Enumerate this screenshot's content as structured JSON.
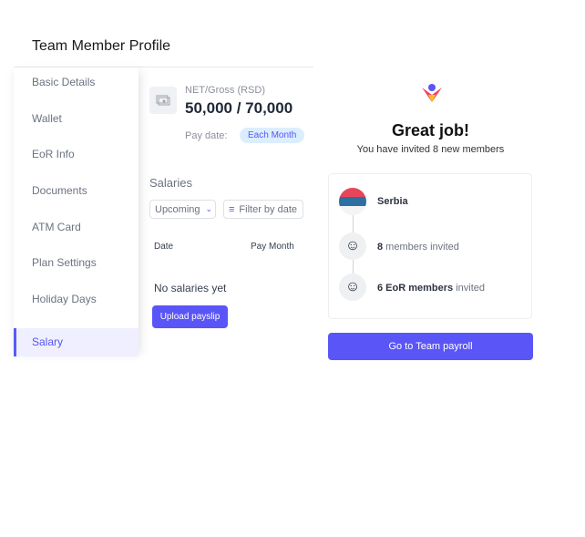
{
  "header": {
    "title": "Team Member Profile"
  },
  "sidebar": {
    "items": [
      {
        "label": "Basic Details"
      },
      {
        "label": "Wallet"
      },
      {
        "label": "EoR Info"
      },
      {
        "label": "Documents"
      },
      {
        "label": "ATM Card"
      },
      {
        "label": "Plan Settings"
      },
      {
        "label": "Holiday Days"
      },
      {
        "label": "Salary",
        "active": true
      }
    ]
  },
  "salary": {
    "net_gross_label": "NET/Gross (RSD)",
    "amount": "50,000 / 70,000",
    "pay_date_label": "Pay date:",
    "pay_date_value": "Each Month",
    "section_title": "Salaries",
    "filter_select": "Upcoming",
    "filter_date": "Filter by date",
    "col_date": "Date",
    "col_pay_month": "Pay Month",
    "empty": "No salaries yet",
    "upload_button": "Upload payslip"
  },
  "success": {
    "title": "Great job!",
    "subtitle": "You have invited 8 new members",
    "country": "Serbia",
    "members_count": "8",
    "members_text": " members invited",
    "eor_count": "6 EoR members",
    "eor_text": " invited",
    "cta": "Go to Team payroll"
  },
  "colors": {
    "accent": "#5a55f6",
    "badge_bg": "#dbeeff"
  }
}
